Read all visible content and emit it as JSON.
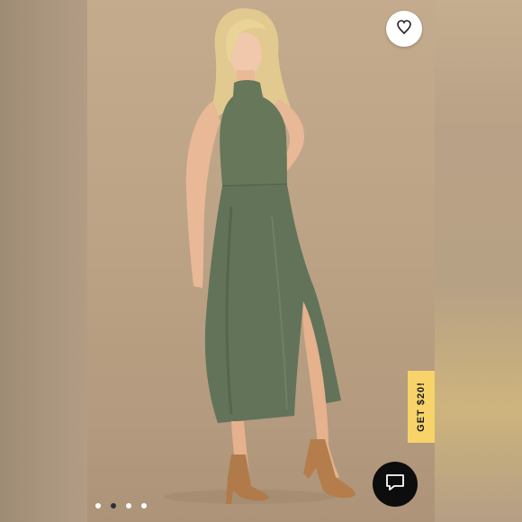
{
  "product_image": {
    "alt_icon": "model-photo",
    "active_slide": 2,
    "slide_count": 4
  },
  "like_button": {
    "icon": "heart-icon"
  },
  "promo": {
    "label": "GET $20!",
    "color": "#f7d36a"
  },
  "chat_button": {
    "icon": "chat-bubble-icon"
  },
  "colors": {
    "dress": "#647556",
    "backdrop": "#bca385",
    "dot_active": "#2b2f3a",
    "dot_inactive": "#ffffff"
  }
}
